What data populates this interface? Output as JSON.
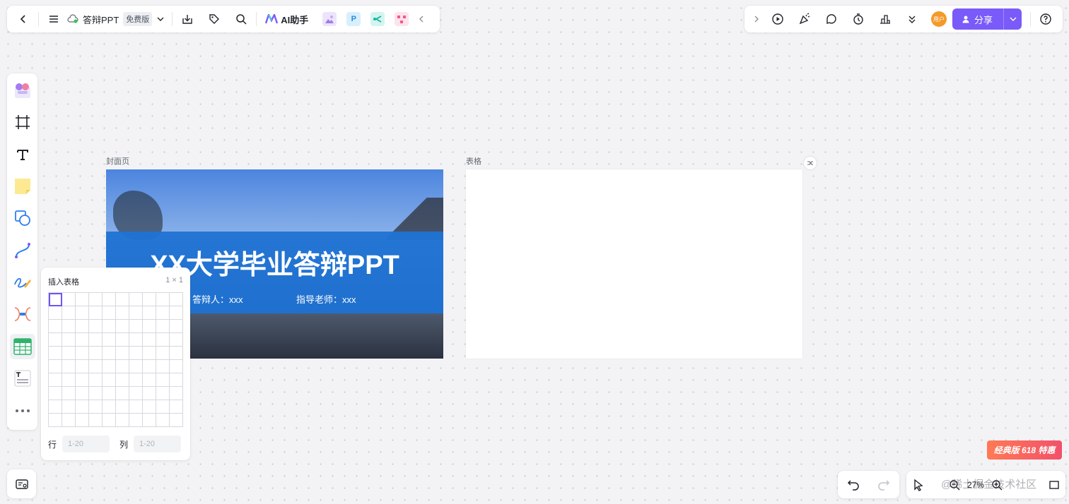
{
  "colors": {
    "accent": "#7a5af8",
    "cover_banner": "#1f72d3",
    "canvas_bg": "#f3f3f5",
    "promo": "#f2506a"
  },
  "topbar": {
    "title": "答辩PPT",
    "plan_badge": "免费版",
    "ai_label": "AI助手",
    "icons": [
      "back-icon",
      "menu-icon",
      "cloud-sync-icon",
      "chevron-down-icon",
      "download-icon",
      "tag-icon",
      "search-icon",
      "ai-logo-icon",
      "image-app-icon",
      "p-app-icon",
      "mindmap-app-icon",
      "flow-app-icon",
      "collapse-icon"
    ],
    "mini_apps": [
      "P"
    ]
  },
  "topbar_right": {
    "icons": [
      "expand-icon",
      "play-icon",
      "celebrate-icon",
      "comment-icon",
      "timer-icon",
      "vote-icon",
      "more-icon",
      "help-icon"
    ],
    "avatar_text": "用户",
    "share_label": "分享"
  },
  "left_toolbar": {
    "tools": [
      "templates-icon",
      "frame-icon",
      "text-icon",
      "sticky-note-icon",
      "shape-icon",
      "connector-icon",
      "pen-icon",
      "mindmap-icon",
      "table-icon",
      "text-block-icon",
      "more-icon"
    ]
  },
  "frames": {
    "cover": {
      "label": "封面页",
      "title": "XX大学毕业答辩PPT",
      "presenter": "答辩人：xxx",
      "advisor": "指导老师：xxx"
    },
    "table": {
      "label": "表格"
    }
  },
  "table_popup": {
    "title": "插入表格",
    "size": "1 × 1",
    "rows_label": "行",
    "cols_label": "列",
    "rows_placeholder": "1-20",
    "cols_placeholder": "1-20"
  },
  "bottom": {
    "zoom": "27%",
    "watermark": "@稀土掘金技术社区",
    "promo": "经典版 618 特惠"
  }
}
